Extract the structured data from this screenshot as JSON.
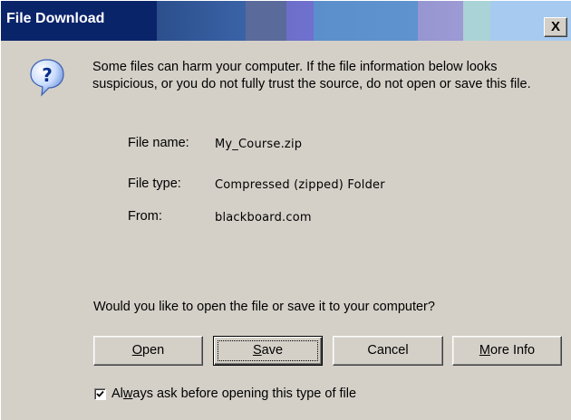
{
  "window": {
    "title": "File Download",
    "close_glyph": "X"
  },
  "icons": {
    "message_icon": "question-icon"
  },
  "message": {
    "warning": "Some files can harm your computer. If the file information below looks suspicious, or you do not fully trust the source, do not open or save this file."
  },
  "file_info": {
    "name_label": "File name:",
    "name_value": "My_Course.zip",
    "type_label": "File type:",
    "type_value": "Compressed (zipped) Folder",
    "from_label": "From:",
    "from_value": "blackboard.com"
  },
  "prompt": {
    "question": "Would you like to open the file or save it to your computer?"
  },
  "buttons": {
    "open": {
      "pre": "",
      "key": "O",
      "post": "pen"
    },
    "save": {
      "pre": "",
      "key": "S",
      "post": "ave"
    },
    "cancel": {
      "label": "Cancel"
    },
    "more_info": {
      "pre": "",
      "key": "M",
      "post": "ore Info"
    }
  },
  "checkbox": {
    "checked": true,
    "pre": "Al",
    "key": "w",
    "post": "ays ask before opening this type of file"
  },
  "colors": {
    "title_bg": "#0a246a",
    "face": "#d4d0c8",
    "title_text": "#ffffff"
  }
}
